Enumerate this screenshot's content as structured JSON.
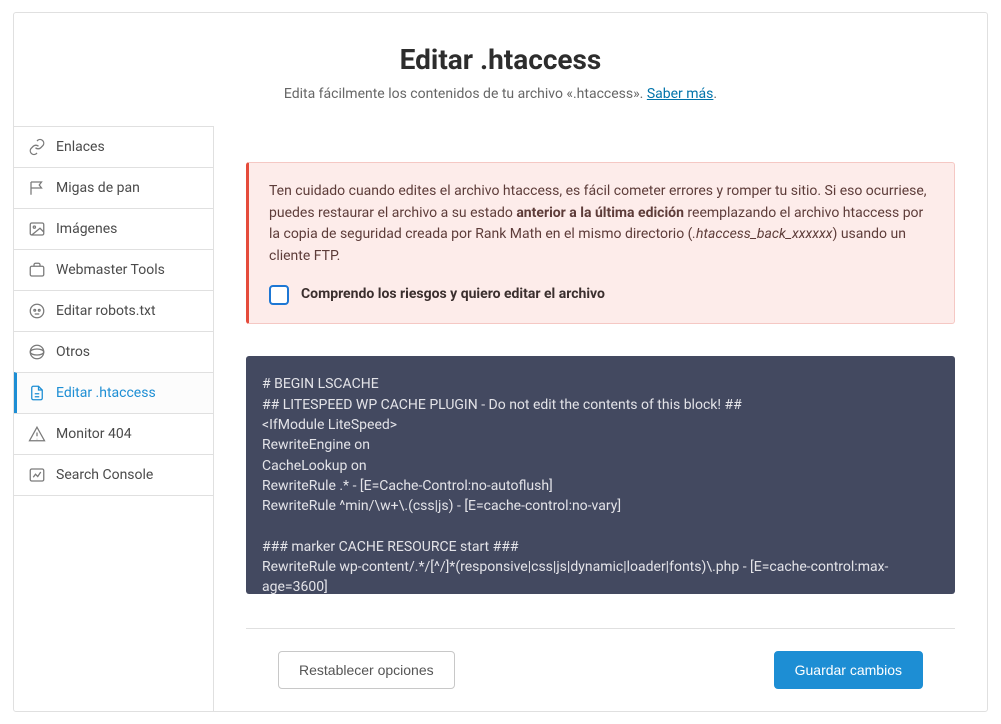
{
  "header": {
    "title": "Editar .htaccess",
    "subtitle_before": "Edita fácilmente los contenidos de tu archivo «.htaccess». ",
    "subtitle_link": "Saber más",
    "subtitle_after": "."
  },
  "sidebar": {
    "items": [
      {
        "label": "Enlaces",
        "icon": "link-icon",
        "active": false
      },
      {
        "label": "Migas de pan",
        "icon": "flag-icon",
        "active": false
      },
      {
        "label": "Imágenes",
        "icon": "image-icon",
        "active": false
      },
      {
        "label": "Webmaster Tools",
        "icon": "briefcase-icon",
        "active": false
      },
      {
        "label": "Editar robots.txt",
        "icon": "robot-icon",
        "active": false
      },
      {
        "label": "Otros",
        "icon": "layers-icon",
        "active": false
      },
      {
        "label": "Editar .htaccess",
        "icon": "file-text-icon",
        "active": true
      },
      {
        "label": "Monitor 404",
        "icon": "warning-icon",
        "active": false
      },
      {
        "label": "Search Console",
        "icon": "chart-icon",
        "active": false
      }
    ]
  },
  "alert": {
    "text_before": "Ten cuidado cuando edites el archivo htaccess, es fácil cometer errores y romper tu sitio. Si eso ocurriese, puedes restaurar el archivo a su estado ",
    "text_bold": "anterior a la última edición",
    "text_mid": " reemplazando el archivo htaccess por la copia de seguridad creada por Rank Math en el mismo directorio (",
    "text_italic": ".htaccess_back_xxxxxx",
    "text_after": ") usando un cliente FTP.",
    "checkbox_label": "Comprendo los riesgos y quiero editar el archivo"
  },
  "editor": {
    "content": "# BEGIN LSCACHE\n## LITESPEED WP CACHE PLUGIN - Do not edit the contents of this block! ##\n<IfModule LiteSpeed>\nRewriteEngine on\nCacheLookup on\nRewriteRule .* - [E=Cache-Control:no-autoflush]\nRewriteRule ^min/\\w+\\.(css|js) - [E=cache-control:no-vary]\n\n### marker CACHE RESOURCE start ###\nRewriteRule wp-content/.*/[^/]*(responsive|css|js|dynamic|loader|fonts)\\.php - [E=cache-control:max-age=3600]"
  },
  "footer": {
    "reset_label": "Restablecer opciones",
    "save_label": "Guardar cambios"
  }
}
